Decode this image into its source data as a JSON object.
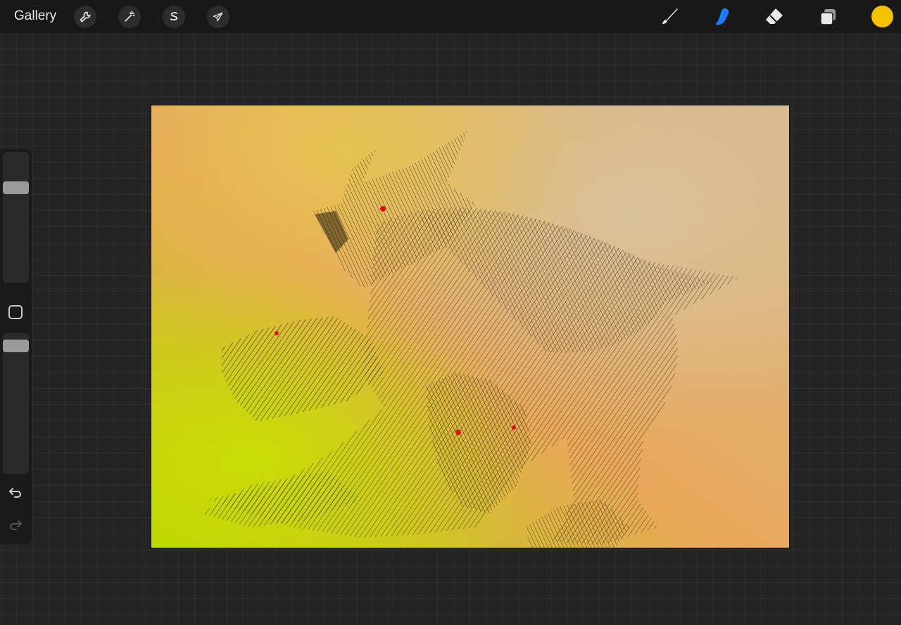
{
  "toolbar": {
    "gallery_label": "Gallery",
    "left_tools": [
      {
        "name": "actions",
        "icon": "wrench-icon"
      },
      {
        "name": "adjustments",
        "icon": "magic-wand-icon"
      },
      {
        "name": "selection",
        "icon": "selection-s-icon"
      },
      {
        "name": "transform",
        "icon": "arrow-cursor-icon"
      }
    ],
    "right_tools": [
      {
        "name": "brush",
        "icon": "brush-icon",
        "active": false
      },
      {
        "name": "smudge",
        "icon": "smudge-finger-icon",
        "active": true
      },
      {
        "name": "eraser",
        "icon": "eraser-icon",
        "active": false
      },
      {
        "name": "layers",
        "icon": "layers-icon",
        "active": false
      }
    ],
    "current_color": "#f5c200",
    "active_tool_color": "#1a7cff"
  },
  "sidebar": {
    "brush_size_level": 0.75,
    "opacity_level": 0.95,
    "icons": [
      "modify-square-icon",
      "undo-icon",
      "redo-icon"
    ]
  },
  "canvas": {
    "artwork": "three-headed-wolf-sketch",
    "background_colors": [
      "#b9d400",
      "#e9a85a",
      "#d8b98c"
    ],
    "eye_color": "#e01010"
  }
}
